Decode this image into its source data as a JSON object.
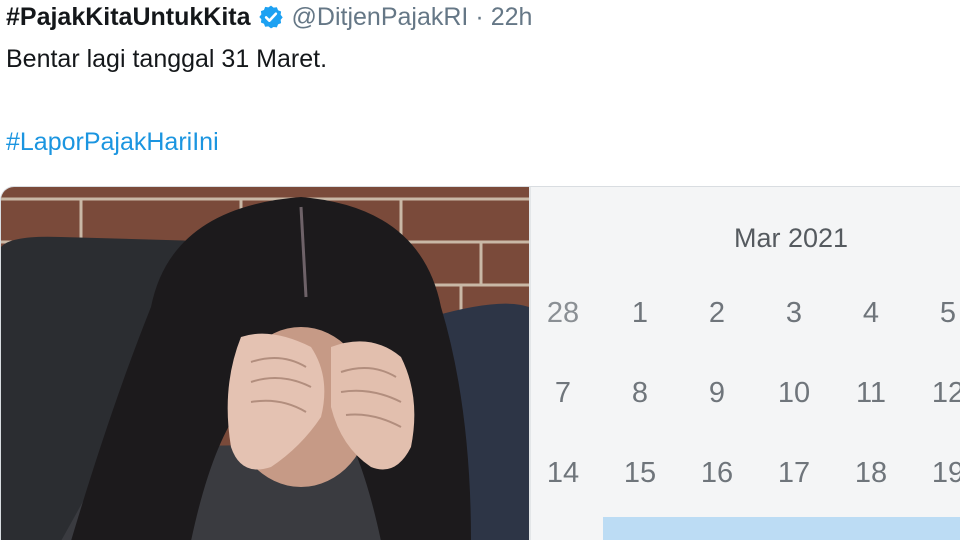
{
  "tweet": {
    "display_name": "#PajakKitaUntukKita",
    "handle": "@DitjenPajakRI",
    "separator": "·",
    "time": "22h",
    "text_line1": "Bentar lagi tanggal 31 Maret.",
    "hashtag": "#LaporPajakHariIni"
  },
  "calendar": {
    "month_label": "Mar 2021",
    "weeks": [
      [
        "28",
        "1",
        "2",
        "3",
        "4",
        "5"
      ],
      [
        "7",
        "8",
        "9",
        "10",
        "11",
        "12"
      ],
      [
        "14",
        "15",
        "16",
        "17",
        "18",
        "19"
      ]
    ]
  },
  "icons": {
    "verified": "verified-badge-icon"
  },
  "colors": {
    "link": "#1b95e0",
    "verified": "#1da1f2",
    "text": "#14171a",
    "muted": "#657786",
    "calendar_bg": "#f4f5f6",
    "calendar_highlight": "#bcdcf4"
  }
}
